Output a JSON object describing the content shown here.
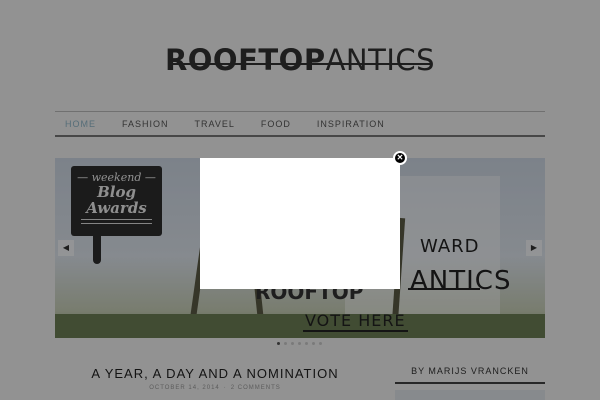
{
  "site": {
    "logo_bold": "ROOFTOP",
    "logo_light": "ANTICS"
  },
  "nav": {
    "items": [
      "HOME",
      "FASHION",
      "TRAVEL",
      "FOOD",
      "INSPIRATION"
    ],
    "active_index": 0,
    "active_color": "#8fb6c9"
  },
  "slider": {
    "sign_top": "— weekend —",
    "sign_line1": "Blog",
    "sign_line2": "Awards",
    "award_text": "WARD",
    "antics_text": "ANTICS",
    "rooftop_fragment": "ROOFTOP",
    "vote_text": "VOTE HERE",
    "prev_icon": "◀",
    "next_icon": "▶",
    "dot_count": 7,
    "active_dot": 0
  },
  "post": {
    "title": "A YEAR, A DAY AND A NOMINATION",
    "date": "OCTOBER 14, 2014",
    "comments": "2 COMMENTS"
  },
  "sidebar": {
    "title": "BY MARIJS VRANCKEN"
  },
  "modal": {
    "close_icon": "✕"
  }
}
